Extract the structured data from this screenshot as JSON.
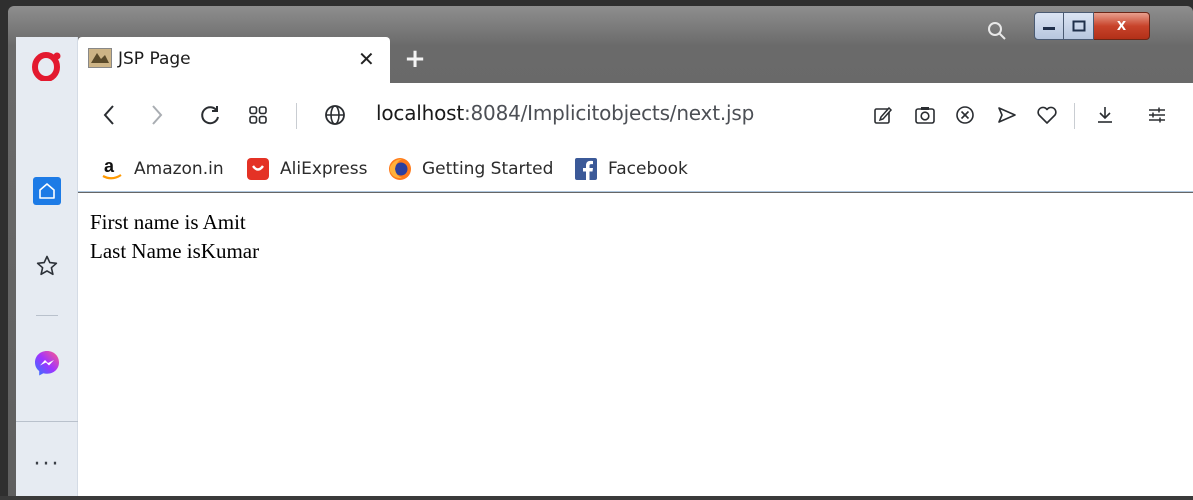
{
  "tab": {
    "title": "JSP Page",
    "close_glyph": "✕"
  },
  "new_tab_glyph": "+",
  "address": {
    "host": "localhost",
    "rest": ":8084/Implicitobjects/next.jsp"
  },
  "bookmarks": [
    {
      "label": "Amazon.in",
      "icon": "amazon-icon"
    },
    {
      "label": "AliExpress",
      "icon": "aliexpress-icon"
    },
    {
      "label": "Getting Started",
      "icon": "firefox-icon"
    },
    {
      "label": "Facebook",
      "icon": "facebook-icon"
    }
  ],
  "content": {
    "line1": "First name is Amit",
    "line2": "Last Name isKumar"
  },
  "sidebar": {
    "more_glyph": "···"
  },
  "window_controls": {
    "minimize": "▁",
    "maximize": "▢",
    "close": "X"
  },
  "colors": {
    "accent_blue": "#1d7be6",
    "opera_red": "#e3192f",
    "messenger_purple": "#8a3cf0",
    "facebook_blue": "#3b5998",
    "aliexpress_red": "#e43225"
  }
}
